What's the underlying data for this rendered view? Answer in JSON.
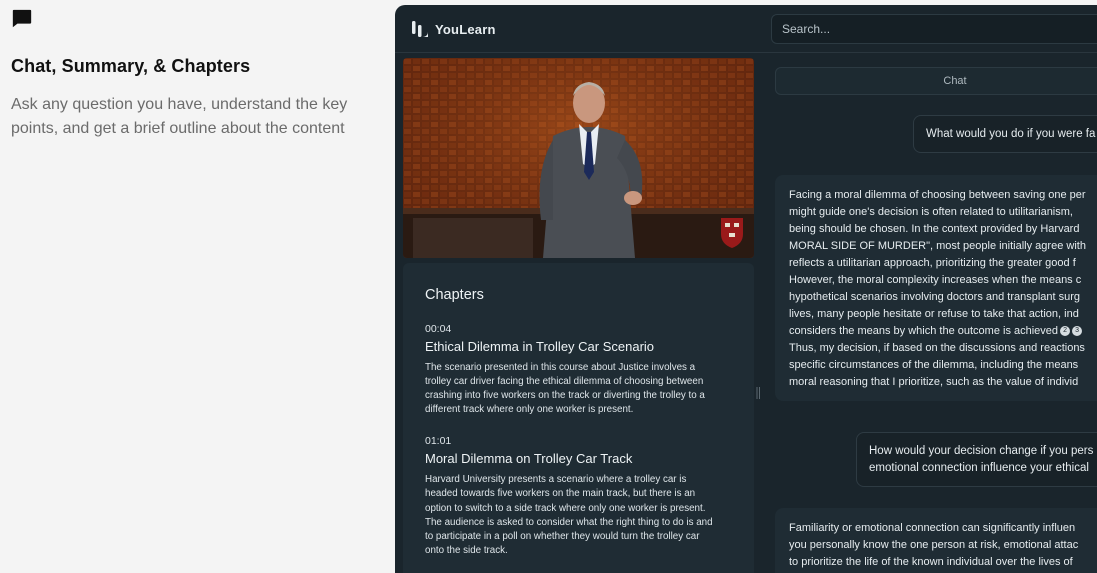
{
  "feature": {
    "icon": "chat-bubble-icon",
    "title": "Chat, Summary, & Chapters",
    "description": "Ask any question you have, understand the key points, and get a brief outline about the content"
  },
  "app": {
    "brand": "YouLearn",
    "search_placeholder": "Search..."
  },
  "chapters": {
    "heading": "Chapters",
    "items": [
      {
        "time": "00:04",
        "title": "Ethical Dilemma in Trolley Car Scenario",
        "desc_lines": [
          "The scenario presented in this course about Justice involves a",
          "trolley car driver facing the ethical dilemma of choosing between",
          "crashing into five workers on the track or diverting the trolley to a",
          "different track where only one worker is present."
        ]
      },
      {
        "time": "01:01",
        "title": "Moral Dilemma on Trolley Car Track",
        "desc_lines": [
          "Harvard University presents a scenario where a trolley car is",
          "headed towards five workers on the main track, but there is an",
          "option to switch to a side track where only one worker is present.",
          "The audience is asked to consider what the right thing to do is and",
          "to participate in a poll on whether they would turn the trolley car",
          "onto the side track."
        ]
      }
    ]
  },
  "chat": {
    "tab_label": "Chat",
    "user_message_1": "What would you do if you were fa",
    "ai_response_1_lines": [
      "Facing a moral dilemma of choosing between saving one per",
      "might guide one's decision is often related to utilitarianism,",
      "being should be chosen. In the context provided by Harvard",
      "MORAL SIDE OF MURDER\",",
      "reflects a utilitarian approach, prioritizing the greater good f",
      "However, the moral complexity increases when the means c",
      "hypothetical scenarios involving doctors and transplant surg",
      "lives, many people hesitate or refuse to take that action, ind",
      "considers the means by which the outcome is achieved",
      "Thus, my decision, if based on the discussions and reactions",
      "specific circumstances of the dilemma, including the means",
      "moral reasoning that I prioritize, such as the value of individ"
    ],
    "ai_line4_rest": " most people initially agree with",
    "refs": [
      "2",
      "3"
    ],
    "user_message_2_lines": [
      "How would your decision change if you pers",
      "emotional connection influence your ethical"
    ],
    "ai_response_2_lines": [
      "Familiarity or emotional connection can significantly influen",
      "you personally know the one person at risk, emotional attac",
      "to prioritize the life of the known individual over the lives of"
    ]
  }
}
